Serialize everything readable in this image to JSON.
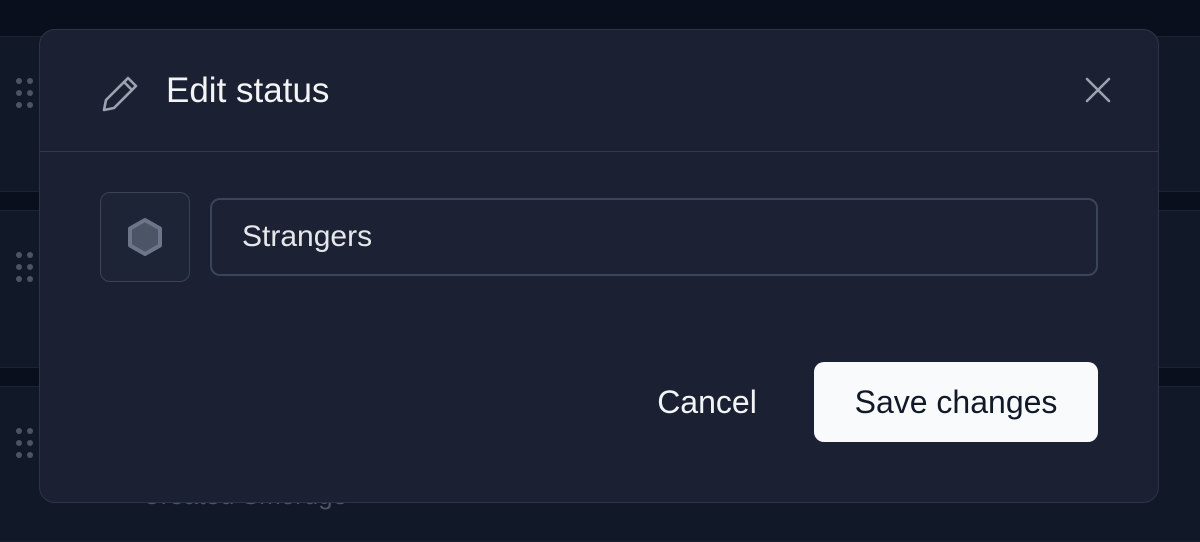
{
  "background": {
    "subtext": "Created Smoruge"
  },
  "modal": {
    "title": "Edit status",
    "title_icon": "pencil-icon",
    "close_icon": "close-icon",
    "status_icon": "hexagon-icon",
    "status_name": {
      "value": "Strangers"
    },
    "cancel_label": "Cancel",
    "save_label": "Save changes"
  },
  "colors": {
    "modal_bg": "#1b2133",
    "page_bg": "#0a0f1e",
    "primary_button_bg": "#f8fafc",
    "icon_gray": "#6b7280"
  }
}
